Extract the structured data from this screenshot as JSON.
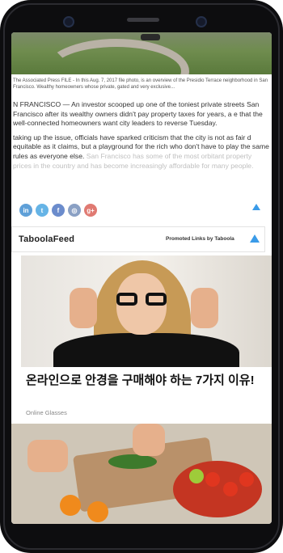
{
  "article": {
    "caption": "The Associated Press  FILE - In this Aug. 7, 2017 file photo, is an overview of the Presidio Terrace neighborhood in San Francisco. Wealthy homeowners whose private, gated and very exclusive...",
    "paragraph1": "N FRANCISCO — An investor scooped up one of the toniest private streets San Francisco after its wealthy owners didn't pay property taxes for years, a e that the well-connected homeowners want city leaders to reverse Tuesday.",
    "paragraph2": "taking up the issue, officials have sparked criticism that the city is not as fair d equitable as it claims, but a playground for the rich who don't have to play the same rules as everyone else.",
    "paragraph2_faded": "San Francisco has some of the most orbitant property prices in the country and has become increasingly affordable for many people."
  },
  "social": {
    "icons": [
      "linkedin-icon",
      "twitter-icon",
      "facebook-icon",
      "instagram-icon",
      "google-plus-icon"
    ],
    "labels": [
      "in",
      "t",
      "f",
      "◎",
      "g+"
    ],
    "colors": [
      "#5fa0d8",
      "#66b4e6",
      "#6b8ccc",
      "#8aa0c4",
      "#e07a72"
    ]
  },
  "taboola": {
    "feed_title": "TaboolaFeed",
    "promoted_label": "Promoted Links by Taboola"
  },
  "ads": [
    {
      "title": "온라인으로 안경을 구매해야 하는 7가지 이유!",
      "source": "Online Glasses"
    }
  ],
  "colors": {
    "frame": "#0d0d0f",
    "taboola_blue": "#3a9be8"
  }
}
